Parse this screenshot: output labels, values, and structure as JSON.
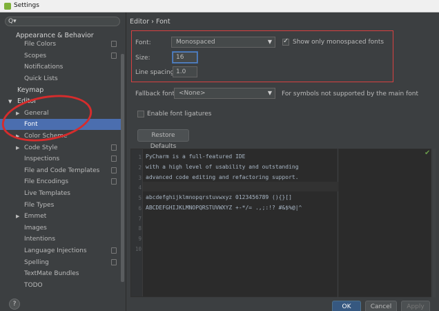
{
  "window": {
    "title": "Settings"
  },
  "search": {
    "icon": "search-icon",
    "glyph": "Q▾"
  },
  "tree": [
    {
      "label": "Appearance & Behavior",
      "kind": "section"
    },
    {
      "label": "File Colors",
      "copy": true
    },
    {
      "label": "Scopes",
      "copy": true
    },
    {
      "label": "Notifications"
    },
    {
      "label": "Quick Lists"
    },
    {
      "label": "Keymap",
      "kind": "section"
    },
    {
      "label": "Editor",
      "kind": "section",
      "expanded": true
    },
    {
      "label": "General",
      "arrow": "▶"
    },
    {
      "label": "Font",
      "selected": true
    },
    {
      "label": "Color Scheme",
      "arrow": "▶"
    },
    {
      "label": "Code Style",
      "arrow": "▶",
      "copy": true
    },
    {
      "label": "Inspections",
      "copy": true
    },
    {
      "label": "File and Code Templates",
      "copy": true
    },
    {
      "label": "File Encodings",
      "copy": true
    },
    {
      "label": "Live Templates"
    },
    {
      "label": "File Types"
    },
    {
      "label": "Emmet",
      "arrow": "▶"
    },
    {
      "label": "Images"
    },
    {
      "label": "Intentions"
    },
    {
      "label": "Language Injections",
      "copy": true
    },
    {
      "label": "Spelling",
      "copy": true
    },
    {
      "label": "TextMate Bundles"
    },
    {
      "label": "TODO"
    }
  ],
  "breadcrumb": "Editor  ›  Font",
  "font": {
    "label": "Font:",
    "value": "Monospaced",
    "show_mono_label": "Show only monospaced fonts",
    "show_mono_checked": true,
    "size_label": "Size:",
    "size_value": "16",
    "spacing_label": "Line spacing:",
    "spacing_value": "1.0",
    "fallback_label": "Fallback font:",
    "fallback_value": "<None>",
    "fallback_hint": "For symbols not supported by the main font",
    "ligatures_label": "Enable font ligatures",
    "ligatures_checked": false,
    "restore_label": "Restore Defaults"
  },
  "preview": {
    "line_numbers": [
      "1",
      "2",
      "3",
      "4",
      "5",
      "6",
      "7",
      "8",
      "9",
      "10"
    ],
    "lines": [
      "PyCharm is a full-featured IDE",
      "with a high level of usability and outstanding",
      "advanced code editing and refactoring support.",
      "",
      "abcdefghijklmnopqrstuvwxyz 0123456789 (){}[]",
      "ABCDEFGHIJKLMNOPQRSTUVWXYZ +-*/= .,;:!? #&$%@|^",
      "",
      "",
      "",
      ""
    ],
    "check_icon": "checkmark-icon"
  },
  "buttons": {
    "ok": "OK",
    "cancel": "Cancel",
    "apply": "Apply",
    "help": "?"
  },
  "colors": {
    "accent": "#4b6eaf",
    "annotation": "#d62c2c",
    "background": "#3c3f41",
    "editor": "#2b2b2b"
  }
}
